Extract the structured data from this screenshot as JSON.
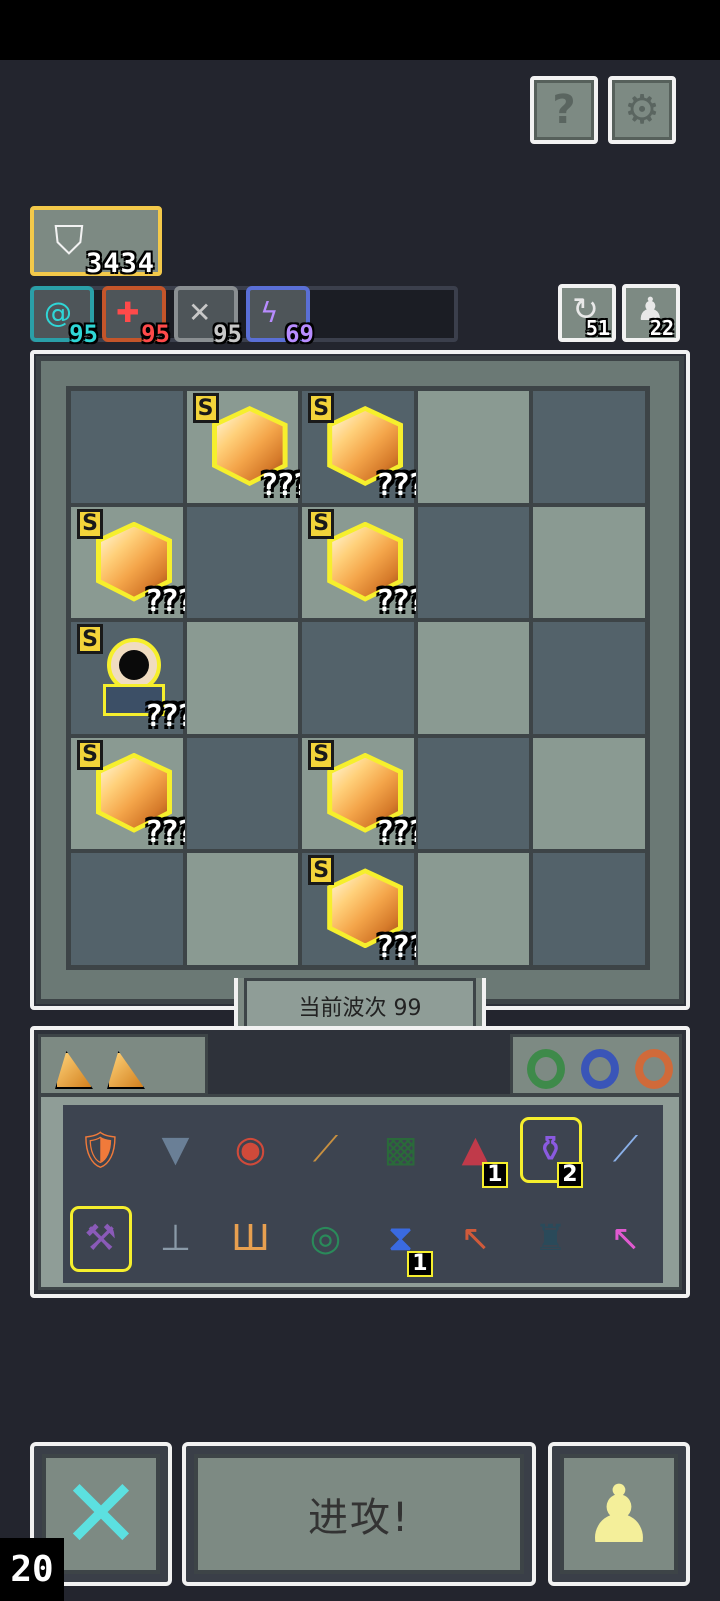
{
  "top_buttons": {
    "help_icon": "question-icon",
    "help_label": "?",
    "settings_icon": "gear-icon",
    "settings_label": "⚙"
  },
  "resources": {
    "gold_icon": "shield-arrow-icon",
    "gold_value": "3434"
  },
  "stats": [
    {
      "icon": "target-icon",
      "glyph": "@",
      "value": "95",
      "color": "#2fd6d6",
      "border": "#2a9fa8"
    },
    {
      "icon": "medic-plus-icon",
      "glyph": "✚",
      "value": "95",
      "color": "#ff4a4a",
      "border": "#c4552a"
    },
    {
      "icon": "wing-icon",
      "glyph": "✕",
      "value": "95",
      "color": "#c8c8c8",
      "border": "#8a8f92"
    },
    {
      "icon": "lightning-icon",
      "glyph": "ϟ",
      "value": "69",
      "color": "#b88cff",
      "border": "#5a6fd6"
    }
  ],
  "side_counters": [
    {
      "icon": "refresh-icon",
      "glyph": "↻",
      "value": "51"
    },
    {
      "icon": "pawn-icon",
      "glyph": "♟",
      "value": "22"
    }
  ],
  "board": {
    "pieces": [
      {
        "row": 0,
        "col": 1,
        "kind": "gem",
        "rank": "S",
        "label": "???"
      },
      {
        "row": 0,
        "col": 2,
        "kind": "gem",
        "rank": "S",
        "label": "???"
      },
      {
        "row": 1,
        "col": 0,
        "kind": "gem",
        "rank": "S",
        "label": "???"
      },
      {
        "row": 1,
        "col": 2,
        "kind": "gem",
        "rank": "S",
        "label": "???"
      },
      {
        "row": 2,
        "col": 0,
        "kind": "cannon",
        "rank": "S",
        "label": "???"
      },
      {
        "row": 3,
        "col": 0,
        "kind": "gem",
        "rank": "S",
        "label": "???"
      },
      {
        "row": 3,
        "col": 2,
        "kind": "gem",
        "rank": "S",
        "label": "???"
      },
      {
        "row": 4,
        "col": 2,
        "kind": "gem",
        "rank": "S",
        "label": "???"
      }
    ]
  },
  "wave": {
    "label": "当前波次 99"
  },
  "inventory": {
    "shards": [
      "shard-icon",
      "shard-icon"
    ],
    "rings": [
      {
        "icon": "ring-green-icon",
        "color": "#3e8a4a"
      },
      {
        "icon": "ring-blue-icon",
        "color": "#3a55b8"
      },
      {
        "icon": "ring-orange-icon",
        "color": "#d06a3a"
      }
    ],
    "items": [
      {
        "icon": "armor-icon",
        "glyph": "🛡",
        "count": "",
        "gold": false,
        "color": "#f07a3a"
      },
      {
        "icon": "pocket-icon",
        "glyph": "▼",
        "count": "",
        "gold": false,
        "color": "#6a7f96"
      },
      {
        "icon": "amulet-icon",
        "glyph": "◉",
        "count": "",
        "gold": false,
        "color": "#d04a3a"
      },
      {
        "icon": "dagger-icon",
        "glyph": "⟋",
        "count": "",
        "gold": false,
        "color": "#c89040"
      },
      {
        "icon": "rune-card-icon",
        "glyph": "▩",
        "count": "",
        "gold": false,
        "color": "#2a6a3a"
      },
      {
        "icon": "helmet-icon",
        "glyph": "▲",
        "count": "1",
        "gold": false,
        "color": "#c03a4a"
      },
      {
        "icon": "potion-icon",
        "glyph": "⚱",
        "count": "2",
        "gold": true,
        "color": "#8a5ae0"
      },
      {
        "icon": "crystal-sword-icon",
        "glyph": "⟋",
        "count": "",
        "gold": false,
        "color": "#8ab0e8"
      },
      {
        "icon": "hammer-icon",
        "glyph": "⚒",
        "count": "",
        "gold": true,
        "color": "#8a5ab8"
      },
      {
        "icon": "lever-icon",
        "glyph": "⊥",
        "count": "",
        "gold": false,
        "color": "#8a9aa8"
      },
      {
        "icon": "claw-icon",
        "glyph": "Ш",
        "count": "",
        "gold": false,
        "color": "#e8a050"
      },
      {
        "icon": "vortex-card-icon",
        "glyph": "◎",
        "count": "",
        "gold": false,
        "color": "#2a8a5a"
      },
      {
        "icon": "hourglass-icon",
        "glyph": "⧗",
        "count": "1",
        "gold": false,
        "color": "#3a6ae0"
      },
      {
        "icon": "arrow-icon",
        "glyph": "↖",
        "count": "",
        "gold": false,
        "color": "#d05a3a"
      },
      {
        "icon": "bell-icon",
        "glyph": "♜",
        "count": "",
        "gold": false,
        "color": "#2a4a5a"
      },
      {
        "icon": "magic-arrow-icon",
        "glyph": "↖",
        "count": "",
        "gold": false,
        "color": "#e05ad0"
      }
    ]
  },
  "actions": {
    "cancel_icon": "x-icon",
    "cancel_glyph": "✕",
    "attack_label": "进攻!",
    "pawn_icon": "pawn-icon",
    "pawn_glyph": "♟"
  },
  "corner_counter": "20"
}
